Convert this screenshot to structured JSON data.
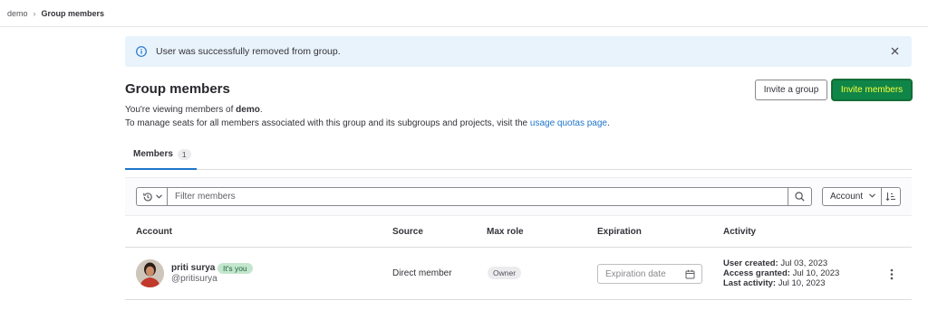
{
  "breadcrumb": {
    "root": "demo",
    "separator": "›",
    "current": "Group members"
  },
  "alert": {
    "message": "User was successfully removed from group.",
    "icon": "info-icon",
    "close_icon": "close-icon"
  },
  "header": {
    "title": "Group members",
    "viewing_prefix": "You're viewing members of ",
    "group_name": "demo",
    "viewing_suffix": ".",
    "manage_text": "To manage seats for all members associated with this group and its subgroups and projects, visit the ",
    "manage_link": "usage quotas page",
    "manage_suffix": "."
  },
  "actions": {
    "invite_group": "Invite a group",
    "invite_members": "Invite members"
  },
  "tabs": [
    {
      "label": "Members",
      "count": "1"
    }
  ],
  "filter": {
    "placeholder": "Filter members",
    "sort_label": "Account"
  },
  "table": {
    "columns": [
      "Account",
      "Source",
      "Max role",
      "Expiration",
      "Activity"
    ],
    "rows": [
      {
        "name": "priti surya",
        "badge": "It's you",
        "username": "@pritisurya",
        "source": "Direct member",
        "role": "Owner",
        "expiration_placeholder": "Expiration date",
        "created_label": "User created:",
        "created": "Jul 03, 2023",
        "access_label": "Access granted:",
        "access": "Jul 10, 2023",
        "last_label": "Last activity:",
        "last": "Jul 10, 2023"
      }
    ]
  },
  "colors": {
    "primary_button": "#108548",
    "link": "#1f75cb",
    "alert_bg": "#e9f3fc"
  }
}
